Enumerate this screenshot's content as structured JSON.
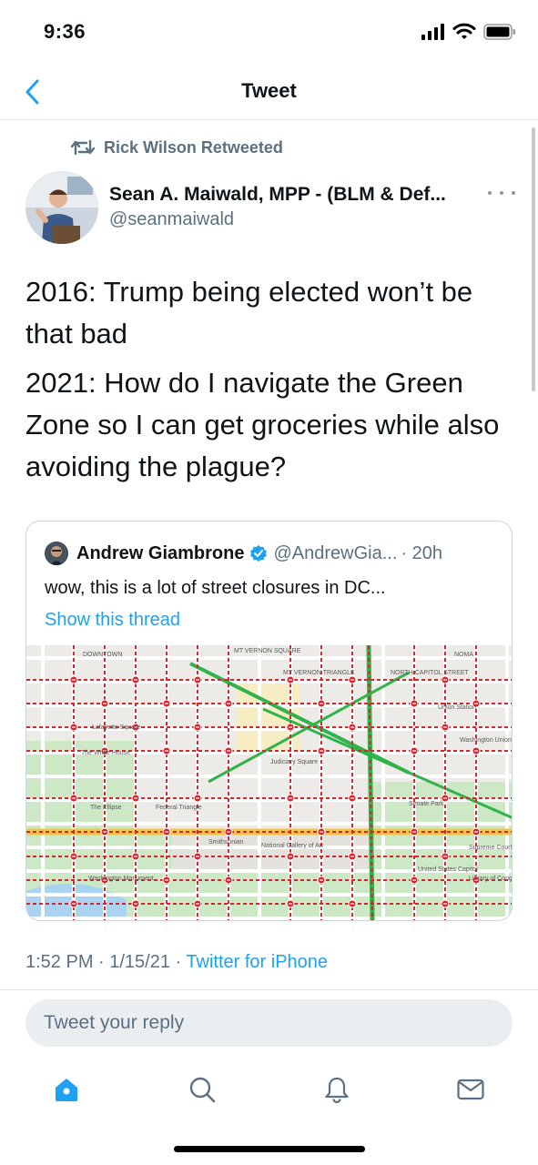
{
  "status_bar": {
    "time": "9:36"
  },
  "nav": {
    "title": "Tweet"
  },
  "retweet": {
    "text": "Rick Wilson Retweeted"
  },
  "author": {
    "name": "Sean A. Maiwald, MPP - (BLM & Def...",
    "handle": "@seanmaiwald"
  },
  "tweet": {
    "lines": [
      "2016: Trump being elected won’t be that bad",
      "2021: How do I navigate the Green Zone so I can get groceries while also avoiding the plague?"
    ]
  },
  "quote": {
    "name": "Andrew Giambrone",
    "handle": "@AndrewGia...",
    "time": "· 20h",
    "text": "wow, this is a lot of street closures in DC...",
    "link": "Show this thread",
    "map_labels": [
      "DOWNTOWN",
      "MT VERNON SQUARE",
      "MT VERNON TRIANGLE",
      "NORTH CAPITOL STREET",
      "NOMA",
      "The White House",
      "Lafayette Square",
      "The Ellipse",
      "Federal Triangle",
      "Judiciary Square",
      "Union Station",
      "Washington Union Station",
      "Senate Park",
      "United States Capitol",
      "National Gallery of Art",
      "Smithsonian",
      "Washington Monument",
      "Supreme Court",
      "Library of Congress"
    ]
  },
  "meta": {
    "time": "1:52 PM · 1/15/21 · ",
    "source": "Twitter for iPhone"
  },
  "reply": {
    "placeholder": "Tweet your reply"
  },
  "tabs": [
    "home-icon",
    "search-icon",
    "notifications-icon",
    "messages-icon"
  ],
  "colors": {
    "accent": "#1da1f2",
    "secondary_text": "#5b7083",
    "closure_red": "#d6252f"
  }
}
